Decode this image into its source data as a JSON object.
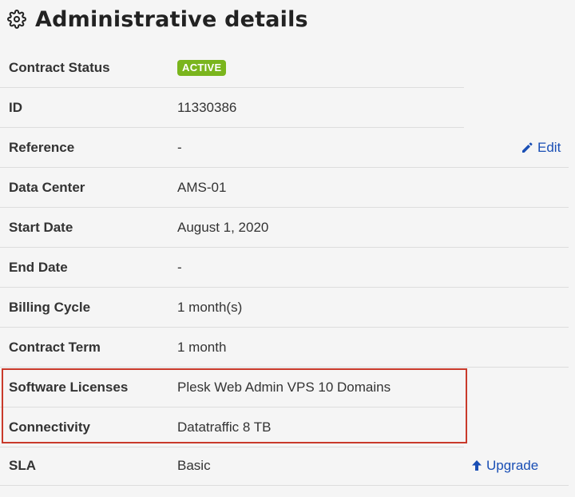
{
  "section": {
    "title": "Administrative details",
    "icon": "gear-icon"
  },
  "rows": [
    {
      "label": "Contract Status",
      "badge": "ACTIVE",
      "badge_color": "#7ab51d"
    },
    {
      "label": "ID",
      "value": "11330386"
    },
    {
      "label": "Reference",
      "value": "-",
      "action": {
        "label": "Edit",
        "icon": "pencil-icon"
      }
    },
    {
      "label": "Data Center",
      "value": "AMS-01"
    },
    {
      "label": "Start Date",
      "value": "August 1, 2020"
    },
    {
      "label": "End Date",
      "value": "-"
    },
    {
      "label": "Billing Cycle",
      "value": "1 month(s)"
    },
    {
      "label": "Contract Term",
      "value": "1 month"
    },
    {
      "label": "Software Licenses",
      "value": "Plesk Web Admin VPS 10 Domains"
    },
    {
      "label": "Connectivity",
      "value": "Datatraffic 8 TB"
    },
    {
      "label": "SLA",
      "value": "Basic",
      "action": {
        "label": "Upgrade",
        "icon": "arrow-up-icon"
      }
    }
  ],
  "colors": {
    "link": "#1a4fb5",
    "highlight_border": "#c93a2b"
  }
}
